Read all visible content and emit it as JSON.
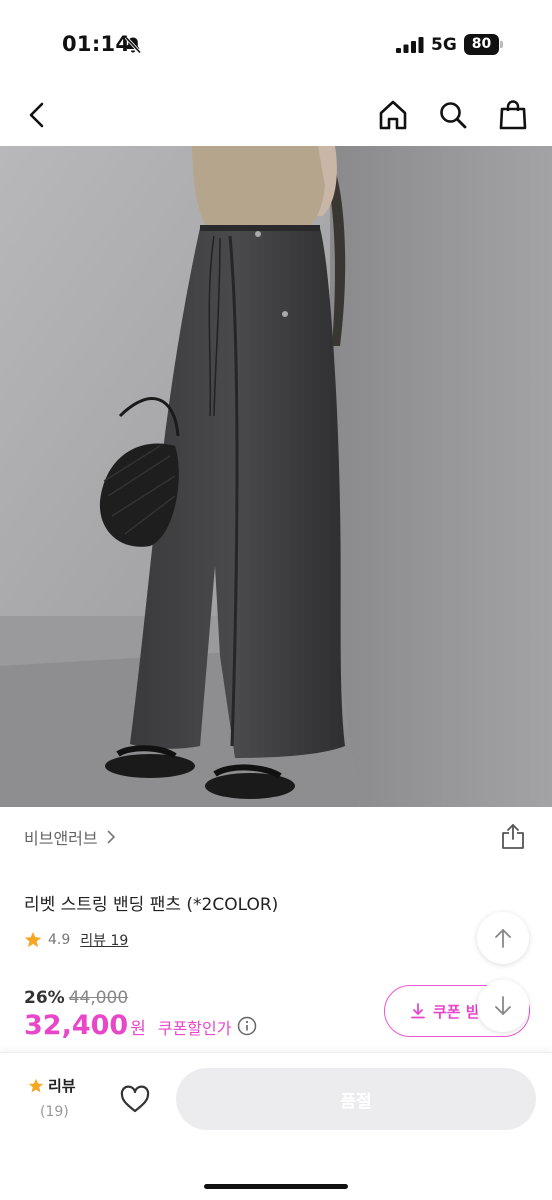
{
  "status_bar": {
    "time": "01:14",
    "network": "5G",
    "battery": "80"
  },
  "nav": {
    "icons": [
      "back-arrow-icon",
      "home-icon",
      "search-icon",
      "shopping-bag-icon"
    ]
  },
  "product": {
    "brand": "비브앤러브",
    "title": "리벳 스트링 밴딩 팬츠 (*2COLOR)",
    "rating": "4.9",
    "review_link": "리뷰 19",
    "discount_rate": "26%",
    "original_price": "44,000",
    "sale_price": "32,400",
    "currency": "원",
    "coupon_note": "쿠폰할인가"
  },
  "coupon_button": {
    "label": "쿠폰 받기"
  },
  "bottom_bar": {
    "review_label": "리뷰",
    "review_count": "(19)",
    "action_label": "품절"
  },
  "colors": {
    "accent": "#e847c9",
    "star": "#f5a623",
    "disabled_button": "#ececee"
  }
}
